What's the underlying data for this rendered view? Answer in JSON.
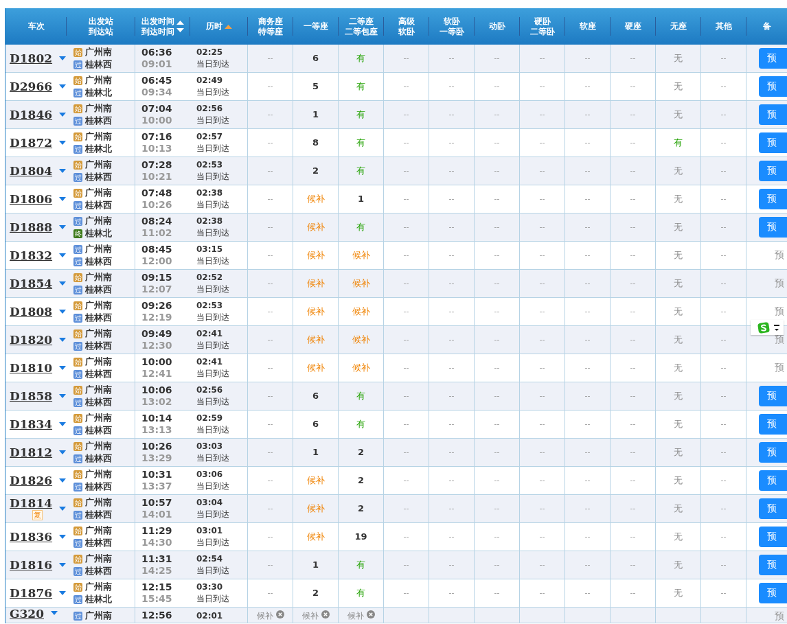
{
  "columns": [
    {
      "lines": [
        "车次"
      ],
      "kind": "plain"
    },
    {
      "lines": [
        "出发站",
        "到达站"
      ],
      "kind": "plain"
    },
    {
      "lines": [
        "出发时间",
        "到达时间"
      ],
      "kind": "sortboth"
    },
    {
      "lines": [
        "历时"
      ],
      "kind": "sortasc"
    },
    {
      "lines": [
        "商务座",
        "特等座"
      ],
      "kind": "plain"
    },
    {
      "lines": [
        "一等座"
      ],
      "kind": "plain"
    },
    {
      "lines": [
        "二等座",
        "二等包座"
      ],
      "kind": "plain"
    },
    {
      "lines": [
        "高级",
        "软卧"
      ],
      "kind": "plain"
    },
    {
      "lines": [
        "软卧",
        "一等卧"
      ],
      "kind": "plain"
    },
    {
      "lines": [
        "动卧"
      ],
      "kind": "plain"
    },
    {
      "lines": [
        "硬卧",
        "二等卧"
      ],
      "kind": "plain"
    },
    {
      "lines": [
        "软座"
      ],
      "kind": "plain"
    },
    {
      "lines": [
        "硬座"
      ],
      "kind": "plain"
    },
    {
      "lines": [
        "无座"
      ],
      "kind": "plain"
    },
    {
      "lines": [
        "其他"
      ],
      "kind": "plain"
    },
    {
      "lines": [
        "备"
      ],
      "kind": "plain"
    }
  ],
  "rows": [
    {
      "train": "D1802",
      "from": {
        "badge": "始",
        "kind": "start",
        "name": "广州南"
      },
      "to": {
        "badge": "过",
        "kind": "pass",
        "name": "桂林西"
      },
      "depart": "06:36",
      "arrive": "09:01",
      "duration": "02:25",
      "day": "当日到达",
      "seats": [
        {
          "text": "--",
          "kind": "none"
        },
        {
          "text": "6",
          "kind": "num"
        },
        {
          "text": "有",
          "kind": "have"
        },
        {
          "text": "--",
          "kind": "none"
        },
        {
          "text": "--",
          "kind": "none"
        },
        {
          "text": "--",
          "kind": "none"
        },
        {
          "text": "--",
          "kind": "none"
        },
        {
          "text": "--",
          "kind": "none"
        },
        {
          "text": "--",
          "kind": "none"
        },
        {
          "text": "无",
          "kind": "wu"
        },
        {
          "text": "--",
          "kind": "none"
        }
      ],
      "book": {
        "text": "预",
        "kind": "button"
      }
    },
    {
      "train": "D2966",
      "from": {
        "badge": "始",
        "kind": "start",
        "name": "广州南"
      },
      "to": {
        "badge": "过",
        "kind": "pass",
        "name": "桂林北"
      },
      "depart": "06:45",
      "arrive": "09:34",
      "duration": "02:49",
      "day": "当日到达",
      "seats": [
        {
          "text": "--",
          "kind": "none"
        },
        {
          "text": "5",
          "kind": "num"
        },
        {
          "text": "有",
          "kind": "have"
        },
        {
          "text": "--",
          "kind": "none"
        },
        {
          "text": "--",
          "kind": "none"
        },
        {
          "text": "--",
          "kind": "none"
        },
        {
          "text": "--",
          "kind": "none"
        },
        {
          "text": "--",
          "kind": "none"
        },
        {
          "text": "--",
          "kind": "none"
        },
        {
          "text": "无",
          "kind": "wu"
        },
        {
          "text": "--",
          "kind": "none"
        }
      ],
      "book": {
        "text": "预",
        "kind": "button"
      }
    },
    {
      "train": "D1846",
      "from": {
        "badge": "始",
        "kind": "start",
        "name": "广州南"
      },
      "to": {
        "badge": "过",
        "kind": "pass",
        "name": "桂林西"
      },
      "depart": "07:04",
      "arrive": "10:00",
      "duration": "02:56",
      "day": "当日到达",
      "seats": [
        {
          "text": "--",
          "kind": "none"
        },
        {
          "text": "1",
          "kind": "num"
        },
        {
          "text": "有",
          "kind": "have"
        },
        {
          "text": "--",
          "kind": "none"
        },
        {
          "text": "--",
          "kind": "none"
        },
        {
          "text": "--",
          "kind": "none"
        },
        {
          "text": "--",
          "kind": "none"
        },
        {
          "text": "--",
          "kind": "none"
        },
        {
          "text": "--",
          "kind": "none"
        },
        {
          "text": "无",
          "kind": "wu"
        },
        {
          "text": "--",
          "kind": "none"
        }
      ],
      "book": {
        "text": "预",
        "kind": "button"
      }
    },
    {
      "train": "D1872",
      "from": {
        "badge": "始",
        "kind": "start",
        "name": "广州南"
      },
      "to": {
        "badge": "过",
        "kind": "pass",
        "name": "桂林北"
      },
      "depart": "07:16",
      "arrive": "10:13",
      "duration": "02:57",
      "day": "当日到达",
      "seats": [
        {
          "text": "--",
          "kind": "none"
        },
        {
          "text": "8",
          "kind": "num"
        },
        {
          "text": "有",
          "kind": "have"
        },
        {
          "text": "--",
          "kind": "none"
        },
        {
          "text": "--",
          "kind": "none"
        },
        {
          "text": "--",
          "kind": "none"
        },
        {
          "text": "--",
          "kind": "none"
        },
        {
          "text": "--",
          "kind": "none"
        },
        {
          "text": "--",
          "kind": "none"
        },
        {
          "text": "有",
          "kind": "have"
        },
        {
          "text": "--",
          "kind": "none"
        }
      ],
      "book": {
        "text": "预",
        "kind": "button"
      }
    },
    {
      "train": "D1804",
      "from": {
        "badge": "始",
        "kind": "start",
        "name": "广州南"
      },
      "to": {
        "badge": "过",
        "kind": "pass",
        "name": "桂林西"
      },
      "depart": "07:28",
      "arrive": "10:21",
      "duration": "02:53",
      "day": "当日到达",
      "seats": [
        {
          "text": "--",
          "kind": "none"
        },
        {
          "text": "2",
          "kind": "num"
        },
        {
          "text": "有",
          "kind": "have"
        },
        {
          "text": "--",
          "kind": "none"
        },
        {
          "text": "--",
          "kind": "none"
        },
        {
          "text": "--",
          "kind": "none"
        },
        {
          "text": "--",
          "kind": "none"
        },
        {
          "text": "--",
          "kind": "none"
        },
        {
          "text": "--",
          "kind": "none"
        },
        {
          "text": "无",
          "kind": "wu"
        },
        {
          "text": "--",
          "kind": "none"
        }
      ],
      "book": {
        "text": "预",
        "kind": "button"
      }
    },
    {
      "train": "D1806",
      "from": {
        "badge": "始",
        "kind": "start",
        "name": "广州南"
      },
      "to": {
        "badge": "过",
        "kind": "pass",
        "name": "桂林西"
      },
      "depart": "07:48",
      "arrive": "10:26",
      "duration": "02:38",
      "day": "当日到达",
      "seats": [
        {
          "text": "--",
          "kind": "none"
        },
        {
          "text": "候补",
          "kind": "wait"
        },
        {
          "text": "1",
          "kind": "num"
        },
        {
          "text": "--",
          "kind": "none"
        },
        {
          "text": "--",
          "kind": "none"
        },
        {
          "text": "--",
          "kind": "none"
        },
        {
          "text": "--",
          "kind": "none"
        },
        {
          "text": "--",
          "kind": "none"
        },
        {
          "text": "--",
          "kind": "none"
        },
        {
          "text": "无",
          "kind": "wu"
        },
        {
          "text": "--",
          "kind": "none"
        }
      ],
      "book": {
        "text": "预",
        "kind": "button"
      }
    },
    {
      "train": "D1888",
      "from": {
        "badge": "过",
        "kind": "pass",
        "name": "广州南"
      },
      "to": {
        "badge": "终",
        "kind": "end",
        "name": "桂林北"
      },
      "depart": "08:24",
      "arrive": "11:02",
      "duration": "02:38",
      "day": "当日到达",
      "seats": [
        {
          "text": "--",
          "kind": "none"
        },
        {
          "text": "候补",
          "kind": "wait"
        },
        {
          "text": "有",
          "kind": "have"
        },
        {
          "text": "--",
          "kind": "none"
        },
        {
          "text": "--",
          "kind": "none"
        },
        {
          "text": "--",
          "kind": "none"
        },
        {
          "text": "--",
          "kind": "none"
        },
        {
          "text": "--",
          "kind": "none"
        },
        {
          "text": "--",
          "kind": "none"
        },
        {
          "text": "无",
          "kind": "wu"
        },
        {
          "text": "--",
          "kind": "none"
        }
      ],
      "book": {
        "text": "预",
        "kind": "button"
      }
    },
    {
      "train": "D1832",
      "from": {
        "badge": "过",
        "kind": "pass",
        "name": "广州南"
      },
      "to": {
        "badge": "过",
        "kind": "pass",
        "name": "桂林西"
      },
      "depart": "08:45",
      "arrive": "12:00",
      "duration": "03:15",
      "day": "当日到达",
      "seats": [
        {
          "text": "--",
          "kind": "none"
        },
        {
          "text": "候补",
          "kind": "wait"
        },
        {
          "text": "候补",
          "kind": "wait"
        },
        {
          "text": "--",
          "kind": "none"
        },
        {
          "text": "--",
          "kind": "none"
        },
        {
          "text": "--",
          "kind": "none"
        },
        {
          "text": "--",
          "kind": "none"
        },
        {
          "text": "--",
          "kind": "none"
        },
        {
          "text": "--",
          "kind": "none"
        },
        {
          "text": "无",
          "kind": "wu"
        },
        {
          "text": "--",
          "kind": "none"
        }
      ],
      "book": {
        "text": "预",
        "kind": "text"
      }
    },
    {
      "train": "D1854",
      "from": {
        "badge": "始",
        "kind": "start",
        "name": "广州南"
      },
      "to": {
        "badge": "过",
        "kind": "pass",
        "name": "桂林西"
      },
      "depart": "09:15",
      "arrive": "12:07",
      "duration": "02:52",
      "day": "当日到达",
      "seats": [
        {
          "text": "--",
          "kind": "none"
        },
        {
          "text": "候补",
          "kind": "wait"
        },
        {
          "text": "候补",
          "kind": "wait"
        },
        {
          "text": "--",
          "kind": "none"
        },
        {
          "text": "--",
          "kind": "none"
        },
        {
          "text": "--",
          "kind": "none"
        },
        {
          "text": "--",
          "kind": "none"
        },
        {
          "text": "--",
          "kind": "none"
        },
        {
          "text": "--",
          "kind": "none"
        },
        {
          "text": "无",
          "kind": "wu"
        },
        {
          "text": "--",
          "kind": "none"
        }
      ],
      "book": {
        "text": "预",
        "kind": "text"
      }
    },
    {
      "train": "D1808",
      "from": {
        "badge": "始",
        "kind": "start",
        "name": "广州南"
      },
      "to": {
        "badge": "过",
        "kind": "pass",
        "name": "桂林西"
      },
      "depart": "09:26",
      "arrive": "12:19",
      "duration": "02:53",
      "day": "当日到达",
      "seats": [
        {
          "text": "--",
          "kind": "none"
        },
        {
          "text": "候补",
          "kind": "wait"
        },
        {
          "text": "候补",
          "kind": "wait"
        },
        {
          "text": "--",
          "kind": "none"
        },
        {
          "text": "--",
          "kind": "none"
        },
        {
          "text": "--",
          "kind": "none"
        },
        {
          "text": "--",
          "kind": "none"
        },
        {
          "text": "--",
          "kind": "none"
        },
        {
          "text": "--",
          "kind": "none"
        },
        {
          "text": "无",
          "kind": "wu"
        },
        {
          "text": "--",
          "kind": "none"
        }
      ],
      "book": {
        "text": "预",
        "kind": "text"
      }
    },
    {
      "train": "D1820",
      "from": {
        "badge": "始",
        "kind": "start",
        "name": "广州南"
      },
      "to": {
        "badge": "过",
        "kind": "pass",
        "name": "桂林西"
      },
      "depart": "09:49",
      "arrive": "12:30",
      "duration": "02:41",
      "day": "当日到达",
      "seats": [
        {
          "text": "--",
          "kind": "none"
        },
        {
          "text": "候补",
          "kind": "wait"
        },
        {
          "text": "候补",
          "kind": "wait"
        },
        {
          "text": "--",
          "kind": "none"
        },
        {
          "text": "--",
          "kind": "none"
        },
        {
          "text": "--",
          "kind": "none"
        },
        {
          "text": "--",
          "kind": "none"
        },
        {
          "text": "--",
          "kind": "none"
        },
        {
          "text": "--",
          "kind": "none"
        },
        {
          "text": "无",
          "kind": "wu"
        },
        {
          "text": "--",
          "kind": "none"
        }
      ],
      "book": {
        "text": "预",
        "kind": "text"
      }
    },
    {
      "train": "D1810",
      "from": {
        "badge": "始",
        "kind": "start",
        "name": "广州南"
      },
      "to": {
        "badge": "过",
        "kind": "pass",
        "name": "桂林西"
      },
      "depart": "10:00",
      "arrive": "12:41",
      "duration": "02:41",
      "day": "当日到达",
      "seats": [
        {
          "text": "--",
          "kind": "none"
        },
        {
          "text": "候补",
          "kind": "wait"
        },
        {
          "text": "候补",
          "kind": "wait"
        },
        {
          "text": "--",
          "kind": "none"
        },
        {
          "text": "--",
          "kind": "none"
        },
        {
          "text": "--",
          "kind": "none"
        },
        {
          "text": "--",
          "kind": "none"
        },
        {
          "text": "--",
          "kind": "none"
        },
        {
          "text": "--",
          "kind": "none"
        },
        {
          "text": "无",
          "kind": "wu"
        },
        {
          "text": "--",
          "kind": "none"
        }
      ],
      "book": {
        "text": "预",
        "kind": "text"
      }
    },
    {
      "train": "D1858",
      "from": {
        "badge": "始",
        "kind": "start",
        "name": "广州南"
      },
      "to": {
        "badge": "过",
        "kind": "pass",
        "name": "桂林西"
      },
      "depart": "10:06",
      "arrive": "13:02",
      "duration": "02:56",
      "day": "当日到达",
      "seats": [
        {
          "text": "--",
          "kind": "none"
        },
        {
          "text": "6",
          "kind": "num"
        },
        {
          "text": "有",
          "kind": "have"
        },
        {
          "text": "--",
          "kind": "none"
        },
        {
          "text": "--",
          "kind": "none"
        },
        {
          "text": "--",
          "kind": "none"
        },
        {
          "text": "--",
          "kind": "none"
        },
        {
          "text": "--",
          "kind": "none"
        },
        {
          "text": "--",
          "kind": "none"
        },
        {
          "text": "无",
          "kind": "wu"
        },
        {
          "text": "--",
          "kind": "none"
        }
      ],
      "book": {
        "text": "预",
        "kind": "button"
      }
    },
    {
      "train": "D1834",
      "from": {
        "badge": "始",
        "kind": "start",
        "name": "广州南"
      },
      "to": {
        "badge": "过",
        "kind": "pass",
        "name": "桂林西"
      },
      "depart": "10:14",
      "arrive": "13:13",
      "duration": "02:59",
      "day": "当日到达",
      "seats": [
        {
          "text": "--",
          "kind": "none"
        },
        {
          "text": "6",
          "kind": "num"
        },
        {
          "text": "有",
          "kind": "have"
        },
        {
          "text": "--",
          "kind": "none"
        },
        {
          "text": "--",
          "kind": "none"
        },
        {
          "text": "--",
          "kind": "none"
        },
        {
          "text": "--",
          "kind": "none"
        },
        {
          "text": "--",
          "kind": "none"
        },
        {
          "text": "--",
          "kind": "none"
        },
        {
          "text": "无",
          "kind": "wu"
        },
        {
          "text": "--",
          "kind": "none"
        }
      ],
      "book": {
        "text": "预",
        "kind": "button"
      }
    },
    {
      "train": "D1812",
      "from": {
        "badge": "始",
        "kind": "start",
        "name": "广州南"
      },
      "to": {
        "badge": "过",
        "kind": "pass",
        "name": "桂林西"
      },
      "depart": "10:26",
      "arrive": "13:29",
      "duration": "03:03",
      "day": "当日到达",
      "seats": [
        {
          "text": "--",
          "kind": "none"
        },
        {
          "text": "1",
          "kind": "num"
        },
        {
          "text": "2",
          "kind": "num"
        },
        {
          "text": "--",
          "kind": "none"
        },
        {
          "text": "--",
          "kind": "none"
        },
        {
          "text": "--",
          "kind": "none"
        },
        {
          "text": "--",
          "kind": "none"
        },
        {
          "text": "--",
          "kind": "none"
        },
        {
          "text": "--",
          "kind": "none"
        },
        {
          "text": "无",
          "kind": "wu"
        },
        {
          "text": "--",
          "kind": "none"
        }
      ],
      "book": {
        "text": "预",
        "kind": "button"
      }
    },
    {
      "train": "D1826",
      "from": {
        "badge": "始",
        "kind": "start",
        "name": "广州南"
      },
      "to": {
        "badge": "过",
        "kind": "pass",
        "name": "桂林西"
      },
      "depart": "10:31",
      "arrive": "13:37",
      "duration": "03:06",
      "day": "当日到达",
      "seats": [
        {
          "text": "--",
          "kind": "none"
        },
        {
          "text": "候补",
          "kind": "wait"
        },
        {
          "text": "2",
          "kind": "num"
        },
        {
          "text": "--",
          "kind": "none"
        },
        {
          "text": "--",
          "kind": "none"
        },
        {
          "text": "--",
          "kind": "none"
        },
        {
          "text": "--",
          "kind": "none"
        },
        {
          "text": "--",
          "kind": "none"
        },
        {
          "text": "--",
          "kind": "none"
        },
        {
          "text": "无",
          "kind": "wu"
        },
        {
          "text": "--",
          "kind": "none"
        }
      ],
      "book": {
        "text": "预",
        "kind": "button"
      }
    },
    {
      "train": "D1814",
      "tag": "复",
      "from": {
        "badge": "始",
        "kind": "start",
        "name": "广州南"
      },
      "to": {
        "badge": "过",
        "kind": "pass",
        "name": "桂林西"
      },
      "depart": "10:57",
      "arrive": "14:01",
      "duration": "03:04",
      "day": "当日到达",
      "seats": [
        {
          "text": "--",
          "kind": "none"
        },
        {
          "text": "候补",
          "kind": "wait"
        },
        {
          "text": "2",
          "kind": "num"
        },
        {
          "text": "--",
          "kind": "none"
        },
        {
          "text": "--",
          "kind": "none"
        },
        {
          "text": "--",
          "kind": "none"
        },
        {
          "text": "--",
          "kind": "none"
        },
        {
          "text": "--",
          "kind": "none"
        },
        {
          "text": "--",
          "kind": "none"
        },
        {
          "text": "无",
          "kind": "wu"
        },
        {
          "text": "--",
          "kind": "none"
        }
      ],
      "book": {
        "text": "预",
        "kind": "button"
      }
    },
    {
      "train": "D1836",
      "from": {
        "badge": "始",
        "kind": "start",
        "name": "广州南"
      },
      "to": {
        "badge": "过",
        "kind": "pass",
        "name": "桂林西"
      },
      "depart": "11:29",
      "arrive": "14:30",
      "duration": "03:01",
      "day": "当日到达",
      "seats": [
        {
          "text": "--",
          "kind": "none"
        },
        {
          "text": "候补",
          "kind": "wait"
        },
        {
          "text": "19",
          "kind": "num"
        },
        {
          "text": "--",
          "kind": "none"
        },
        {
          "text": "--",
          "kind": "none"
        },
        {
          "text": "--",
          "kind": "none"
        },
        {
          "text": "--",
          "kind": "none"
        },
        {
          "text": "--",
          "kind": "none"
        },
        {
          "text": "--",
          "kind": "none"
        },
        {
          "text": "无",
          "kind": "wu"
        },
        {
          "text": "--",
          "kind": "none"
        }
      ],
      "book": {
        "text": "预",
        "kind": "button"
      }
    },
    {
      "train": "D1816",
      "from": {
        "badge": "始",
        "kind": "start",
        "name": "广州南"
      },
      "to": {
        "badge": "过",
        "kind": "pass",
        "name": "桂林西"
      },
      "depart": "11:31",
      "arrive": "14:25",
      "duration": "02:54",
      "day": "当日到达",
      "seats": [
        {
          "text": "--",
          "kind": "none"
        },
        {
          "text": "1",
          "kind": "num"
        },
        {
          "text": "有",
          "kind": "have"
        },
        {
          "text": "--",
          "kind": "none"
        },
        {
          "text": "--",
          "kind": "none"
        },
        {
          "text": "--",
          "kind": "none"
        },
        {
          "text": "--",
          "kind": "none"
        },
        {
          "text": "--",
          "kind": "none"
        },
        {
          "text": "--",
          "kind": "none"
        },
        {
          "text": "无",
          "kind": "wu"
        },
        {
          "text": "--",
          "kind": "none"
        }
      ],
      "book": {
        "text": "预",
        "kind": "button"
      }
    },
    {
      "train": "D1876",
      "from": {
        "badge": "始",
        "kind": "start",
        "name": "广州南"
      },
      "to": {
        "badge": "过",
        "kind": "pass",
        "name": "桂林北"
      },
      "depart": "12:15",
      "arrive": "15:45",
      "duration": "03:30",
      "day": "当日到达",
      "seats": [
        {
          "text": "--",
          "kind": "none"
        },
        {
          "text": "2",
          "kind": "num"
        },
        {
          "text": "有",
          "kind": "have"
        },
        {
          "text": "--",
          "kind": "none"
        },
        {
          "text": "--",
          "kind": "none"
        },
        {
          "text": "--",
          "kind": "none"
        },
        {
          "text": "--",
          "kind": "none"
        },
        {
          "text": "--",
          "kind": "none"
        },
        {
          "text": "--",
          "kind": "none"
        },
        {
          "text": "无",
          "kind": "wu"
        },
        {
          "text": "--",
          "kind": "none"
        }
      ],
      "book": {
        "text": "预",
        "kind": "button"
      }
    },
    {
      "train": "G320",
      "partial": true,
      "from": {
        "badge": "过",
        "kind": "pass",
        "name": "广州南"
      },
      "depart": "12:56",
      "duration": "02:01",
      "seats": [
        {
          "text": "候补",
          "kind": "waitoff"
        },
        {
          "text": "候补",
          "kind": "waitoff"
        },
        {
          "text": "候补",
          "kind": "waitoff"
        }
      ],
      "book": {
        "text": "预",
        "kind": "text"
      }
    }
  ]
}
